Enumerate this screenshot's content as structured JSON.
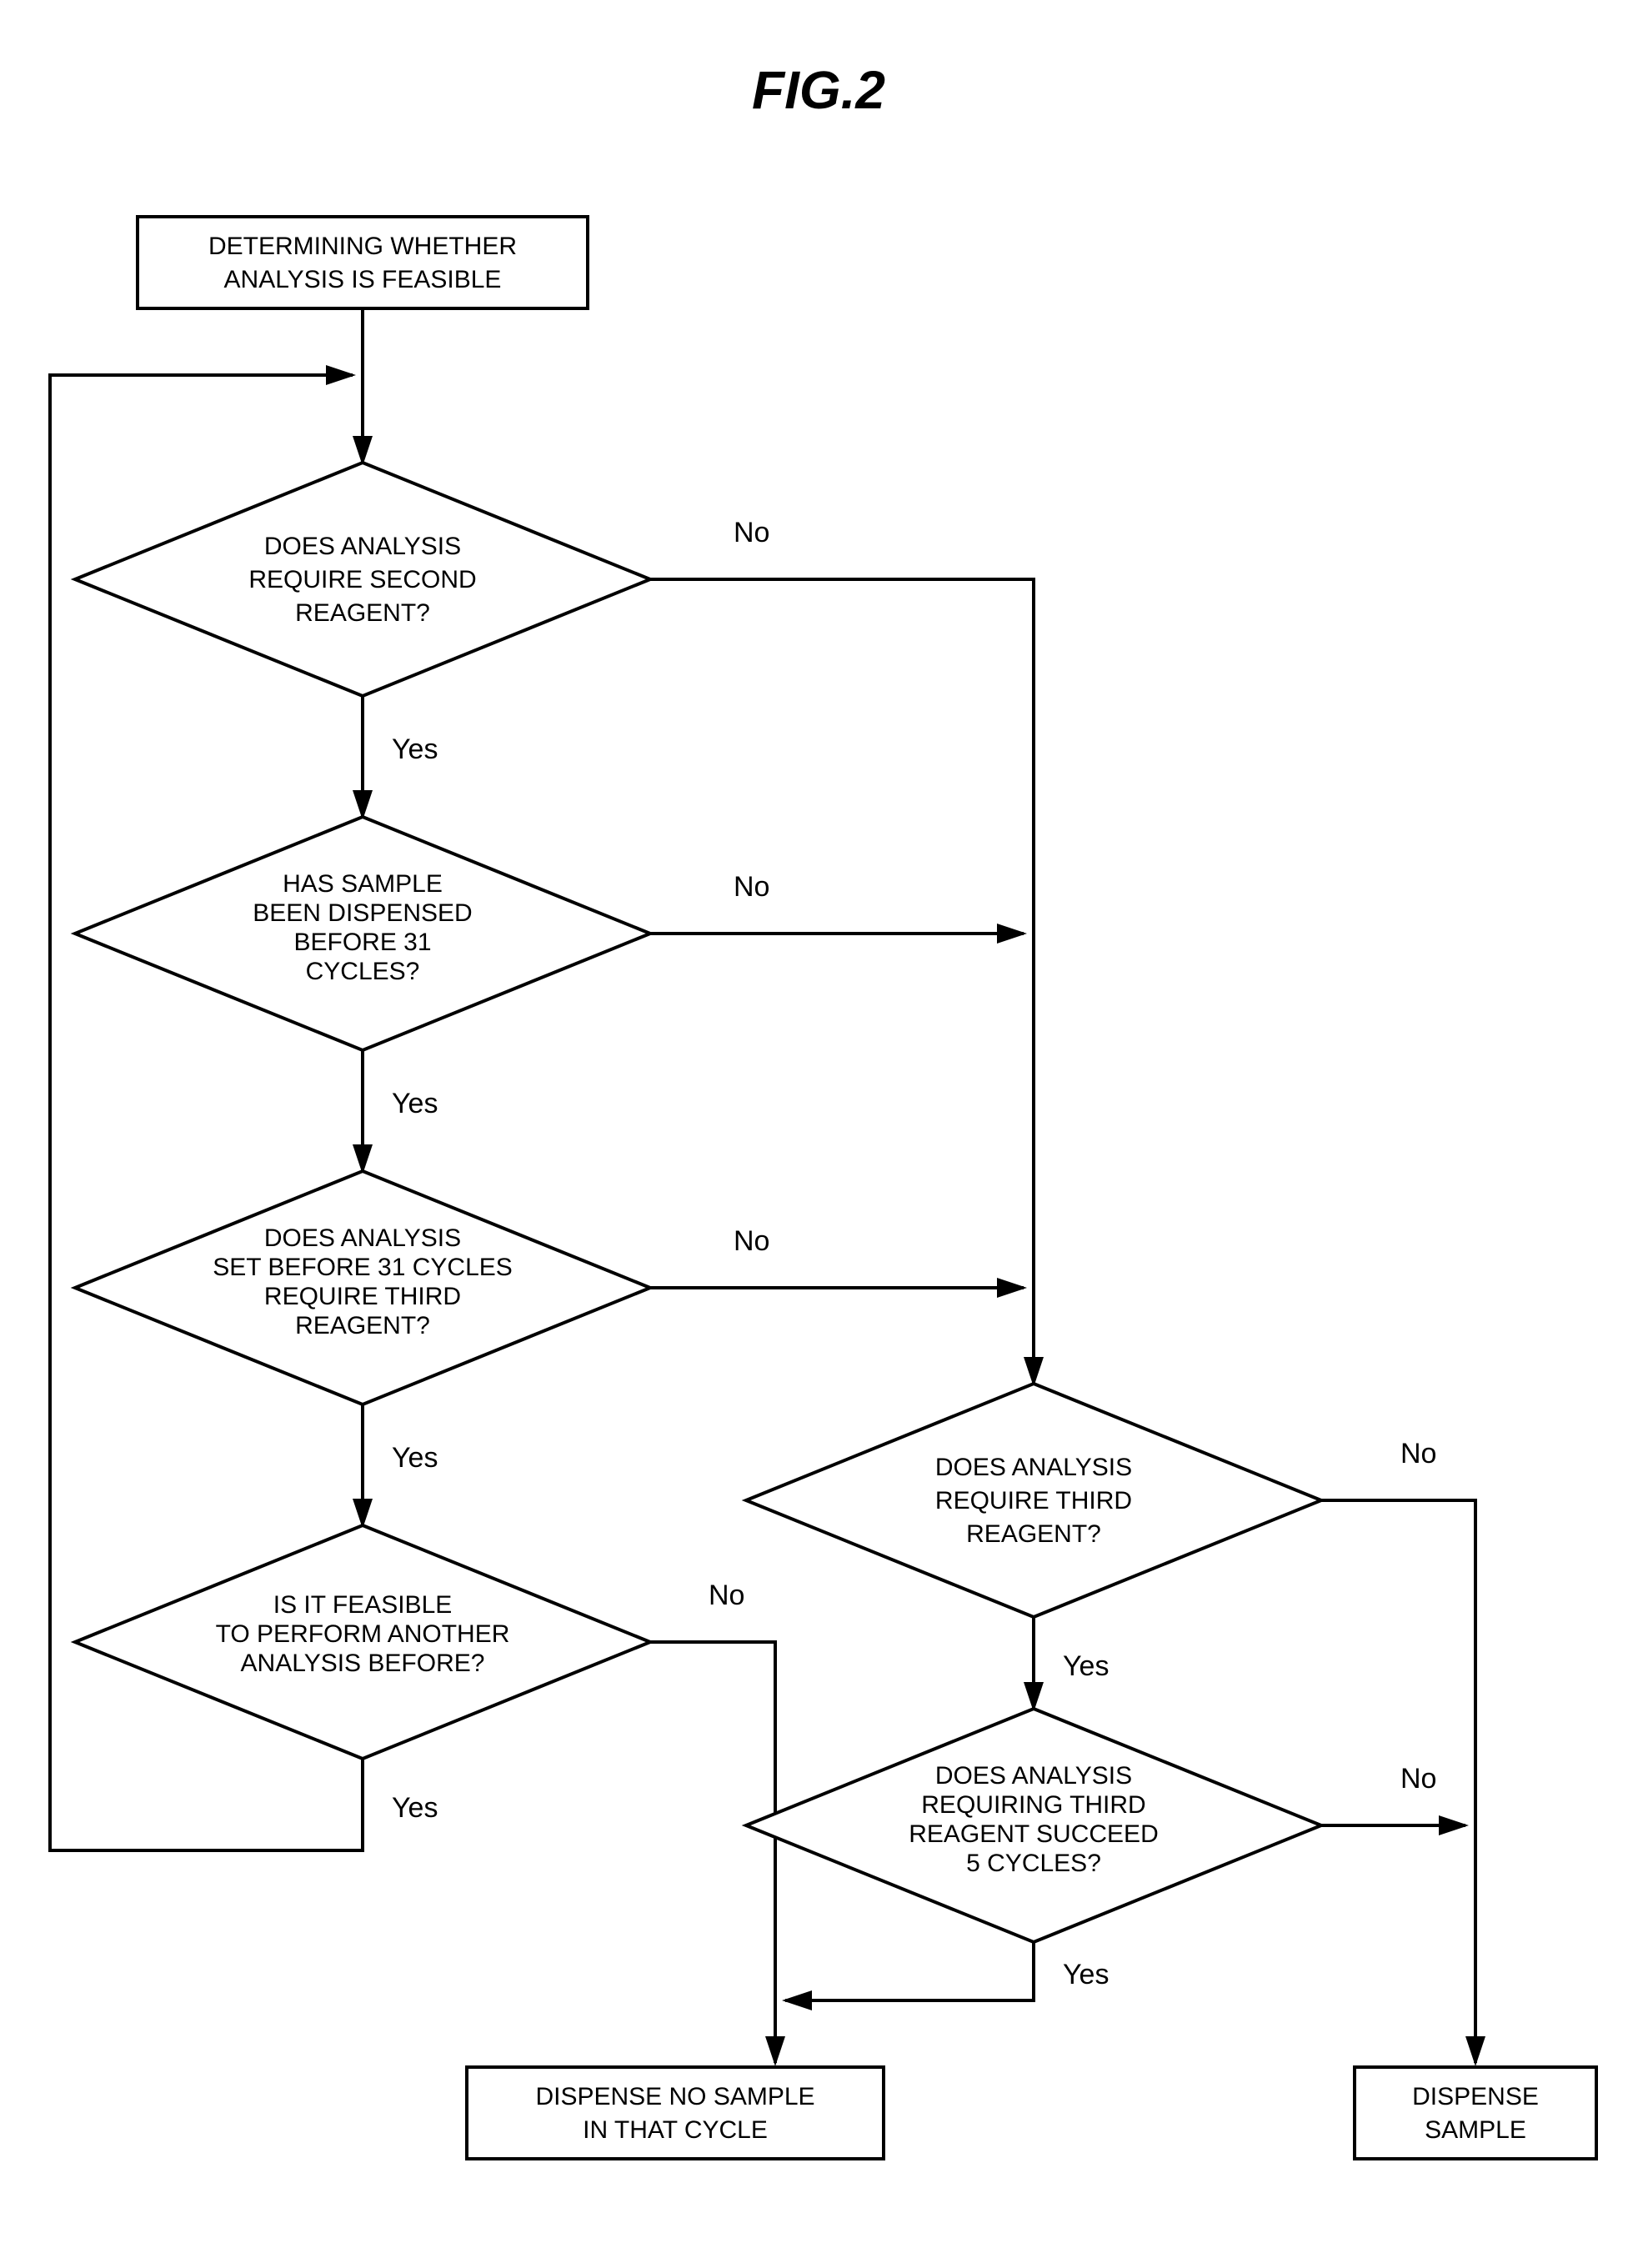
{
  "title": "FIG.2",
  "start": {
    "line1": "DETERMINING WHETHER",
    "line2": "ANALYSIS IS FEASIBLE"
  },
  "d1": {
    "line1": "DOES ANALYSIS",
    "line2": "REQUIRE SECOND",
    "line3": "REAGENT?"
  },
  "d2": {
    "line1": "HAS SAMPLE",
    "line2": "BEEN DISPENSED",
    "line3": "BEFORE 31",
    "line4": "CYCLES?"
  },
  "d3": {
    "line1": "DOES ANALYSIS",
    "line2": "SET BEFORE 31 CYCLES",
    "line3": "REQUIRE THIRD",
    "line4": "REAGENT?"
  },
  "d4": {
    "line1": "IS IT FEASIBLE",
    "line2": "TO PERFORM ANOTHER",
    "line3": "ANALYSIS BEFORE?"
  },
  "d5": {
    "line1": "DOES ANALYSIS",
    "line2": "REQUIRE THIRD",
    "line3": "REAGENT?"
  },
  "d6": {
    "line1": "DOES ANALYSIS",
    "line2": "REQUIRING THIRD",
    "line3": "REAGENT SUCCEED",
    "line4": "5 CYCLES?"
  },
  "end_no_sample": {
    "line1": "DISPENSE NO SAMPLE",
    "line2": "IN THAT CYCLE"
  },
  "end_dispense": {
    "line1": "DISPENSE",
    "line2": "SAMPLE"
  },
  "labels": {
    "yes": "Yes",
    "no": "No"
  }
}
